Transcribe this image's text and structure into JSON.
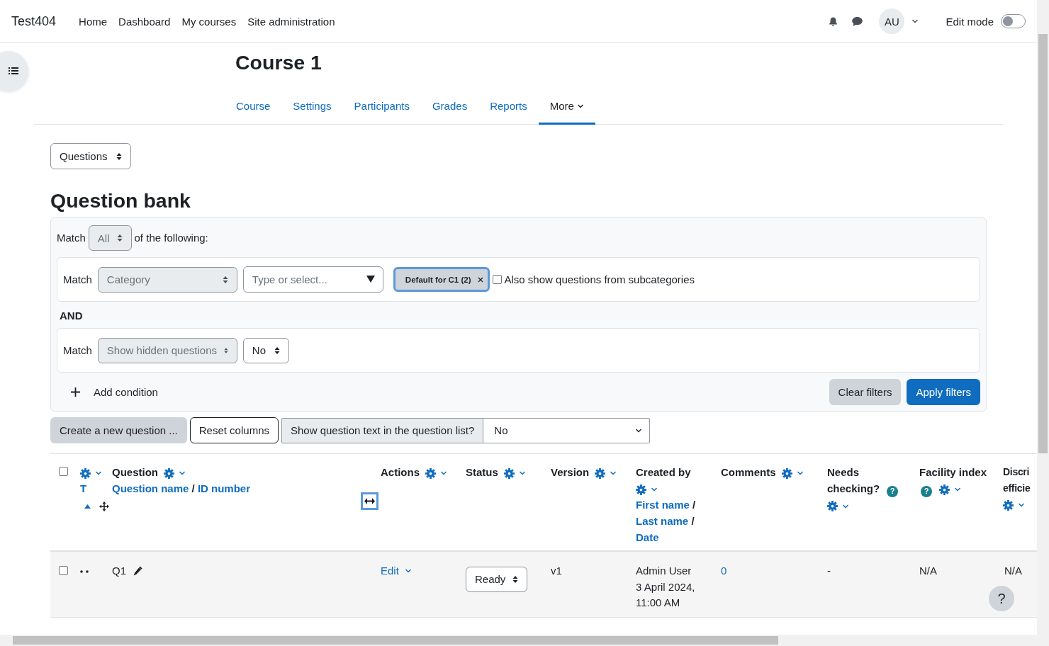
{
  "navbar": {
    "site_name": "Test404",
    "links": [
      {
        "label": "Home"
      },
      {
        "label": "Dashboard"
      },
      {
        "label": "My courses"
      },
      {
        "label": "Site administration"
      }
    ],
    "avatar": "AU",
    "edit_mode": {
      "label": "Edit mode",
      "on": false
    }
  },
  "course": {
    "title": "Course 1",
    "tabs": [
      {
        "label": "Course",
        "selected": false
      },
      {
        "label": "Settings",
        "selected": false
      },
      {
        "label": "Participants",
        "selected": false
      },
      {
        "label": "Grades",
        "selected": false
      },
      {
        "label": "Reports",
        "selected": false
      },
      {
        "label": "More",
        "selected": true,
        "menu": true
      }
    ]
  },
  "view_select": "Questions",
  "heading": "Question bank",
  "filters": {
    "match_label": "Match",
    "match_value": "All",
    "suffix": "of the following:",
    "joiner": "AND",
    "conditions": [
      {
        "kind": "category",
        "match_label": "Match",
        "field": "Category",
        "placeholder": "Type or select...",
        "chip": "Default for C1 (2)",
        "checkbox": {
          "label": "Also show questions from subcategories",
          "checked": false
        }
      },
      {
        "kind": "choice",
        "match_label": "Match",
        "field": "Show hidden questions",
        "value": "No"
      }
    ],
    "add_condition": "Add condition",
    "clear": "Clear filters",
    "apply": "Apply filters"
  },
  "actions": {
    "create": "Create a new question ...",
    "reset": "Reset columns",
    "show_text": {
      "label": "Show question text in the question list?",
      "value": "No"
    }
  },
  "table": {
    "select_all": {
      "checked": false
    },
    "columns": [
      {
        "kind": "type",
        "label": "T",
        "sort_ascending": true
      },
      {
        "kind": "text",
        "title": "Question",
        "sort_links": [
          {
            "label": "Question name",
            "sep": "/"
          },
          {
            "label": "ID number"
          }
        ]
      },
      {
        "kind": "text",
        "title": "Actions"
      },
      {
        "kind": "text",
        "title": "Status"
      },
      {
        "kind": "text",
        "title": "Version"
      },
      {
        "kind": "text",
        "title": "Created by",
        "sort_links": [
          {
            "label": "First name",
            "sep": "/"
          },
          {
            "label": "Last name",
            "sep": "/"
          },
          {
            "label": "Date"
          }
        ]
      },
      {
        "kind": "text",
        "title": "Comments"
      },
      {
        "kind": "text",
        "title": "Needs checking?",
        "help": "?"
      },
      {
        "kind": "text",
        "title": "Facility index",
        "help": "?"
      },
      {
        "kind": "cut",
        "title_lines": [
          "Discri",
          "efficie"
        ]
      }
    ],
    "rows": [
      {
        "selected": false,
        "question": "Q1",
        "actions": "Edit",
        "status": "Ready",
        "version": "v1",
        "created_by": "Admin User",
        "created_date": "3 April 2024, 11:00 AM",
        "comments": "0",
        "needs_checking": "-",
        "facility_index": "N/A",
        "discrimination": "N/A"
      }
    ]
  },
  "help_button": "?"
}
